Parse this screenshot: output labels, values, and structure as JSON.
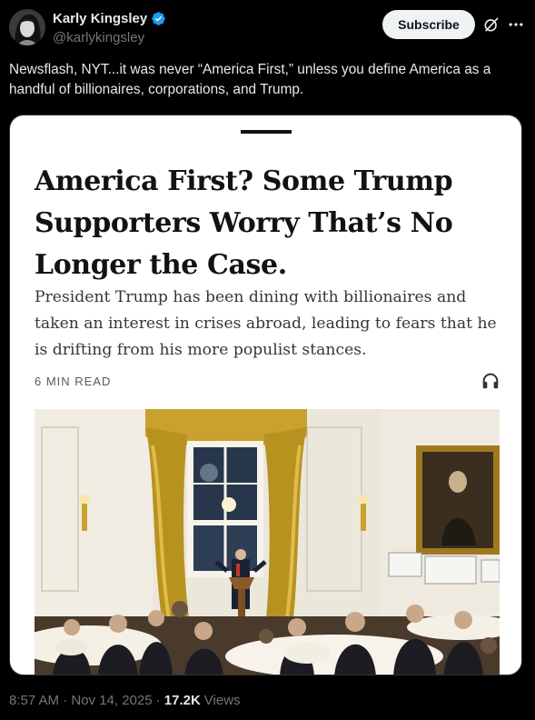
{
  "author": {
    "name": "Karly Kingsley",
    "handle": "@karlykingsley",
    "verified_color": "#1d9bf0"
  },
  "actions": {
    "subscribe_label": "Subscribe",
    "grok_icon": "grok-icon",
    "more_icon": "more-icon"
  },
  "tweet": {
    "text": "Newsflash, NYT...it was never “America First,” unless you define America as a handful of billionaires, corporations, and Trump."
  },
  "article": {
    "headline": "America First? Some Trump Supporters Worry That’s No Longer the Case.",
    "summary": "President Trump has been dining with billionaires and taken an interest in crises abroad, leading to fears that he is drifting from his more populist stances.",
    "read_time": "6 MIN READ",
    "audio_icon": "headphones-icon"
  },
  "meta": {
    "timestamp": "8:57 AM · Nov 14, 2025 ·",
    "views_count": "17.2K",
    "views_label": "Views"
  }
}
